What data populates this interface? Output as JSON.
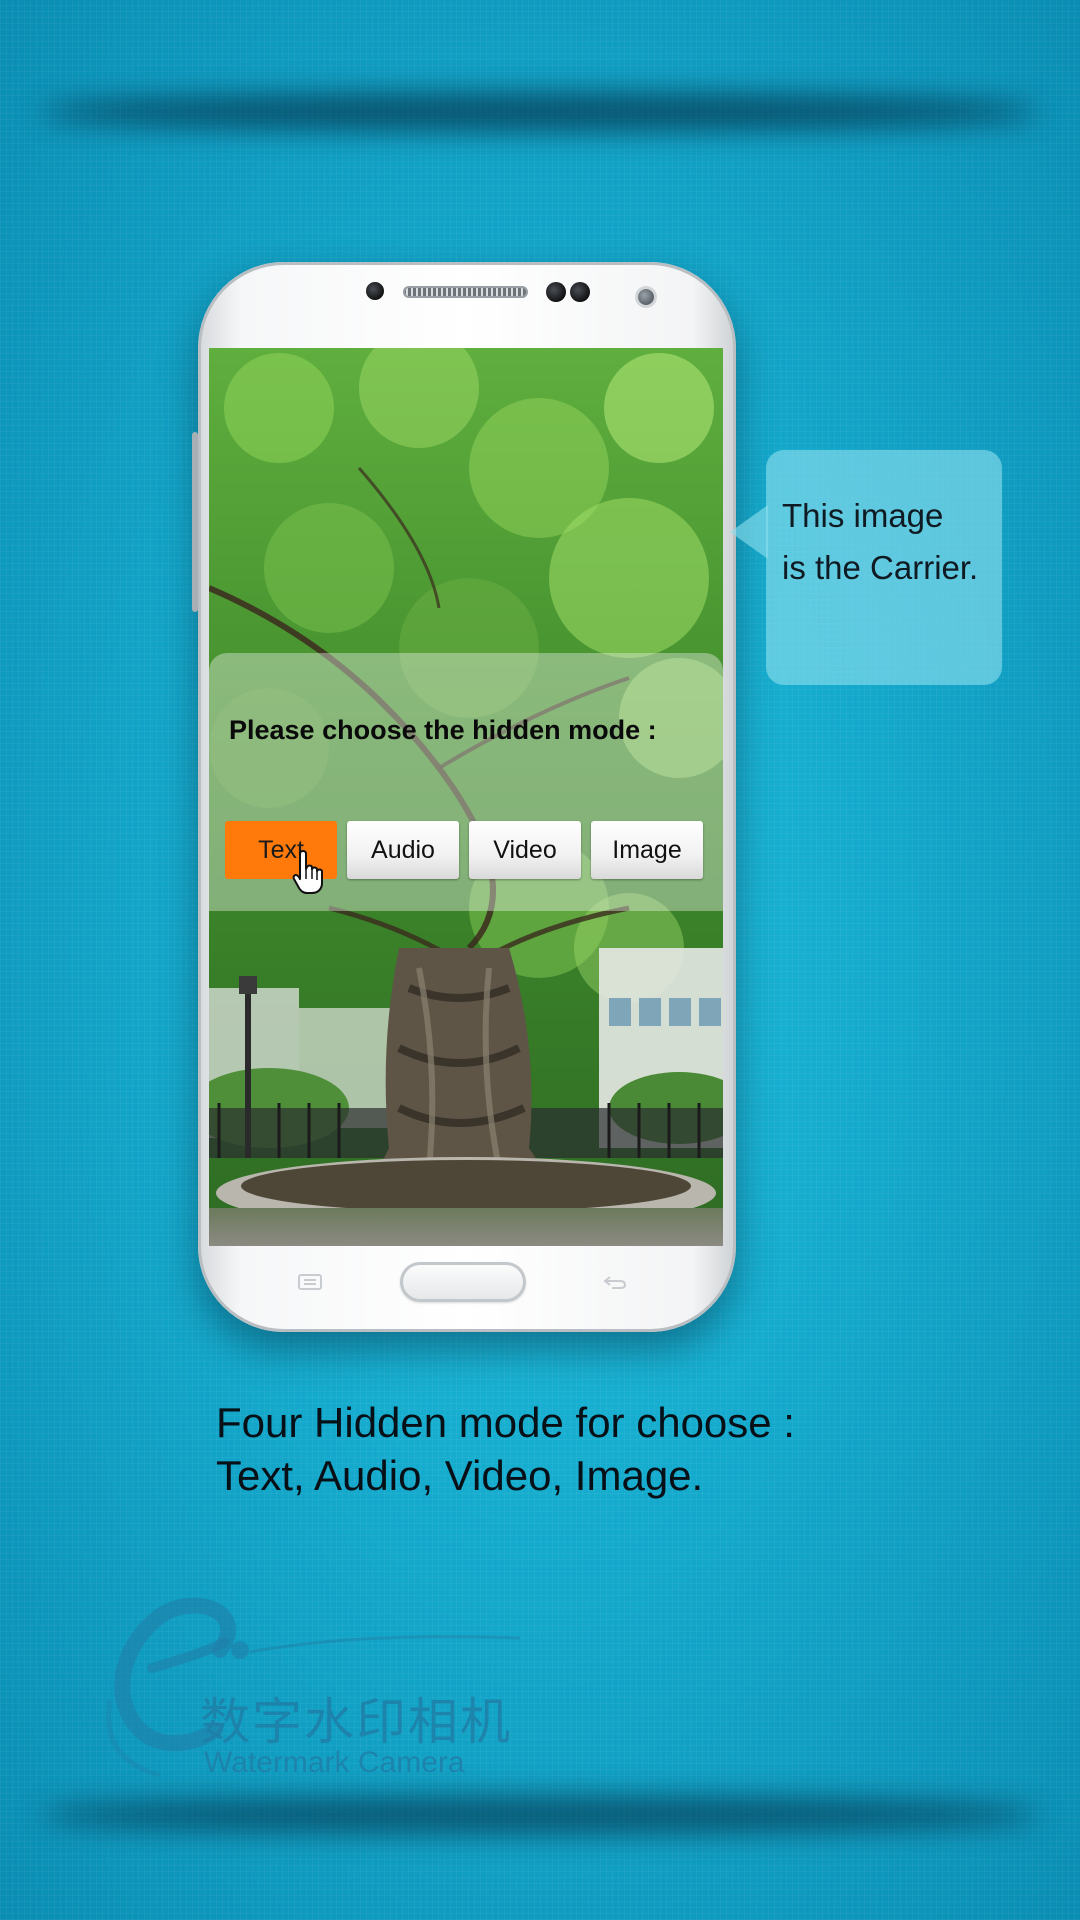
{
  "phone_screen": {
    "panel_title": "Please choose the hidden mode :",
    "mode_buttons": [
      {
        "label": "Text",
        "selected": true
      },
      {
        "label": "Audio",
        "selected": false
      },
      {
        "label": "Video",
        "selected": false
      },
      {
        "label": "Image",
        "selected": false
      }
    ]
  },
  "callout": {
    "line1": "This image",
    "line2": "is the Carrier."
  },
  "caption": {
    "line1": "Four Hidden mode for choose :",
    "line2": "Text, Audio, Video, Image."
  },
  "logo": {
    "chinese_name": "数字水印相机",
    "english_name": "Watermark Camera"
  },
  "colors": {
    "background": "#14a9cc",
    "selected_button": "#ff7a0a",
    "callout_fill": "#8cdeee",
    "logo": "#1f7fa8"
  },
  "icons": [
    "hand-pointer-icon",
    "menu-key-icon",
    "back-key-icon",
    "logo-e-icon"
  ]
}
